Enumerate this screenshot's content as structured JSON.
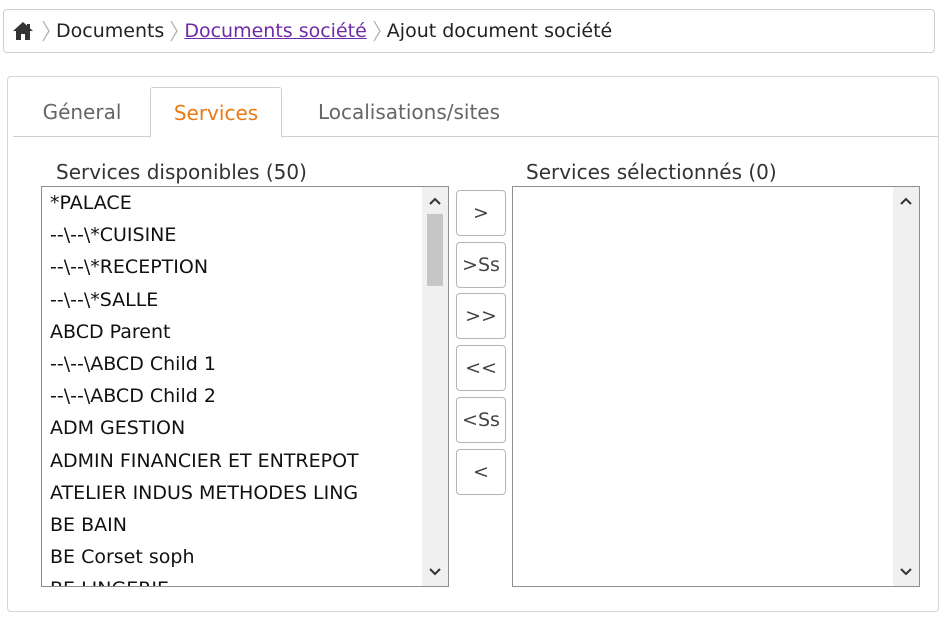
{
  "breadcrumb": {
    "items": [
      "Documents",
      "Documents société",
      "Ajout document société"
    ]
  },
  "tabs": [
    {
      "label": "Géneral"
    },
    {
      "label": "Services"
    },
    {
      "label": "Localisations/sites"
    }
  ],
  "available": {
    "title": "Services disponibles (50)",
    "items": [
      "*PALACE",
      "--\\--\\*CUISINE",
      "--\\--\\*RECEPTION",
      "--\\--\\*SALLE",
      "ABCD Parent",
      "--\\--\\ABCD Child 1",
      "--\\--\\ABCD Child 2",
      "ADM GESTION",
      "ADMIN FINANCIER ET ENTREPOT",
      "ATELIER INDUS METHODES LING",
      "BE BAIN",
      "BE Corset soph",
      "BE LINGERIE"
    ]
  },
  "selected": {
    "title": "Services sélectionnés (0)",
    "items": []
  },
  "buttons": {
    "add": ">",
    "add_sub": ">Ss",
    "add_all": ">>",
    "remove_all": "<<",
    "remove_sub": "<Ss",
    "remove": "<"
  },
  "colors": {
    "active_tab": "#e87a14",
    "link": "#6f2aa8"
  }
}
